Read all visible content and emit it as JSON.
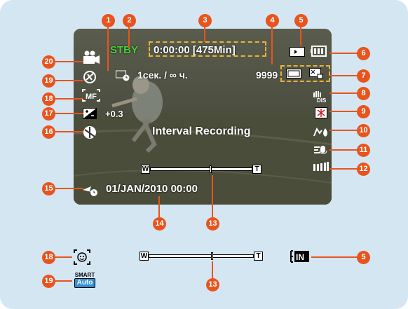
{
  "screen": {
    "status": "STBY",
    "time_info": "0:00:00 [475Min]",
    "interval": "1сек. / ∞ ч.",
    "count": "9999",
    "exposure": "+0.3",
    "mode_label": "Interval Recording",
    "datetime": "01/JAN/2010 00:00",
    "zoom_w": "W",
    "zoom_t": "T"
  },
  "legend": {
    "zoom_w": "W",
    "zoom_t": "T",
    "smart_top": "SMART",
    "smart_bottom": "Auto"
  },
  "badges": [
    "1",
    "2",
    "3",
    "4",
    "5",
    "6",
    "7",
    "8",
    "9",
    "10",
    "11",
    "12",
    "13",
    "14",
    "15",
    "16",
    "17",
    "18",
    "19",
    "20",
    "18",
    "19",
    "13",
    "5"
  ],
  "colors": {
    "panel": "#d5e6f3",
    "badge": "#e8541d",
    "status_green": "#4cd137",
    "highlight": "#e8b33a"
  },
  "icons": [
    "camcorder-mode-icon",
    "anti-shake-icon",
    "manual-focus-icon",
    "exposure-icon",
    "scene-mode-icon",
    "no-power-off-icon",
    "interval-timer-icon",
    "storage-card-icon",
    "battery-icon",
    "quality-icon",
    "resolution-icon",
    "dis-icon",
    "backlight-icon",
    "macro-icon",
    "wind-cut-icon",
    "bar-meter-icon",
    "face-detect-icon",
    "smart-auto-icon",
    "internal-memory-icon"
  ]
}
